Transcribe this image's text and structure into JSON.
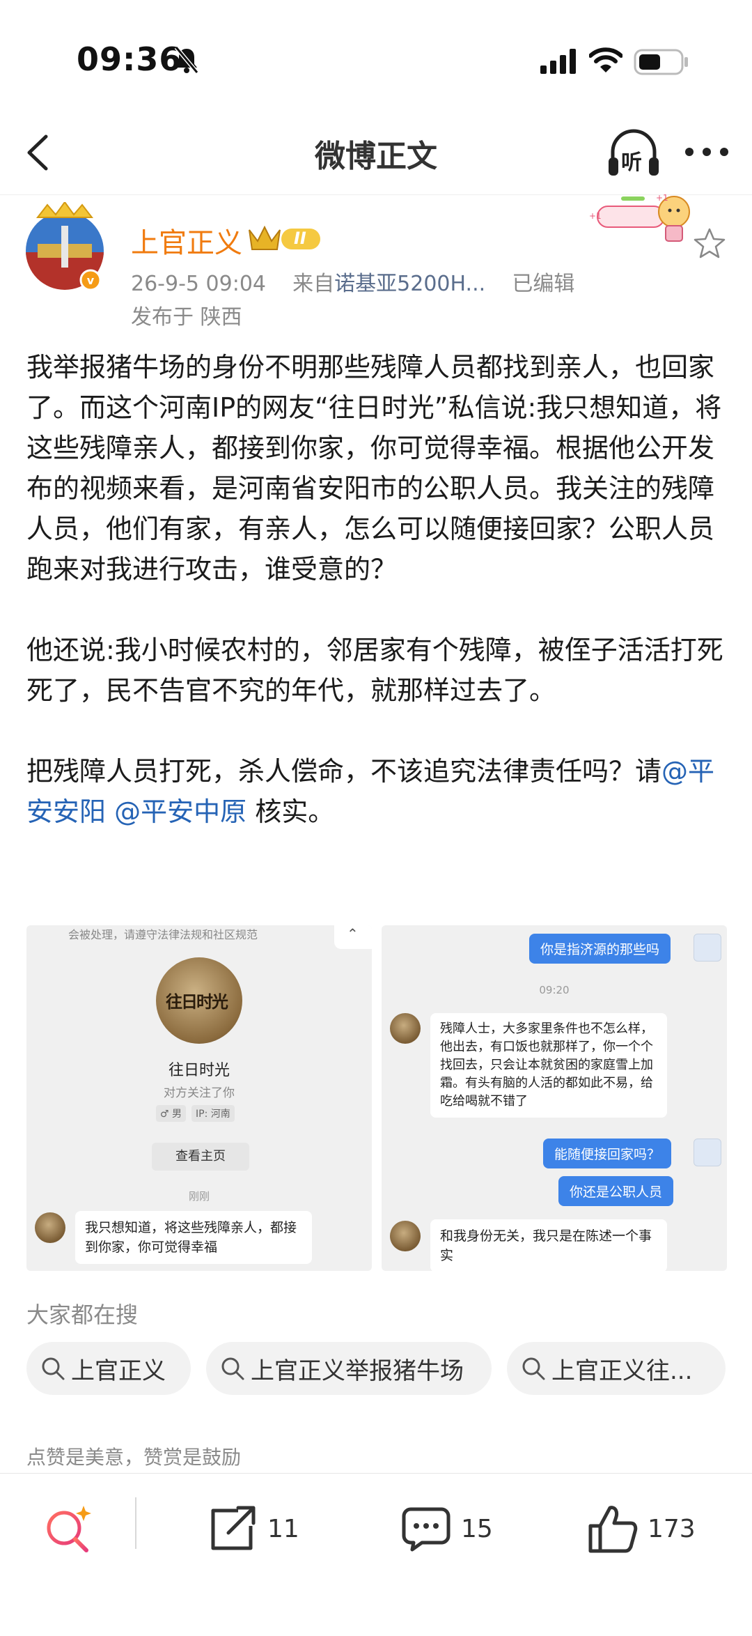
{
  "status_bar": {
    "time": "09:36"
  },
  "nav": {
    "title": "微博正文",
    "listen_label": "听"
  },
  "author": {
    "name": "上官正义",
    "vip_level": "II"
  },
  "meta": {
    "datetime": "26-9-5 09:04",
    "from_prefix": "来自",
    "device": "诺基亚5200H...",
    "edited": "已编辑",
    "location": "发布于 陕西"
  },
  "post": {
    "p1": "我举报猪牛场的身份不明那些残障人员都找到亲人，也回家了。而这个河南IP的网友“往日时光”私信说:我只想知道，将这些残障亲人，都接到你家，你可觉得幸福。根据他公开发布的视频来看，是河南省安阳市的公职人员。我关注的残障人员，他们有家，有亲人，怎么可以随便接回家？公职人员跑来对我进行攻击，谁受意的？",
    "p2": "他还说:我小时候农村的，邻居家有个残障，被侄子活活打死死了，民不告官不究的年代，就那样过去了。",
    "p3_a": "把残障人员打死，杀人偿命，不该追究法律责任吗？请",
    "mention1": "@平安安阳",
    "mention2": "@平安中原",
    "p3_b": " 核实。"
  },
  "image_left": {
    "top_notice": "会被处理，请遵守法律法规和社区规范",
    "avatar_text": "往日时光",
    "profile_name": "往日时光",
    "follows_you": "对方关注了你",
    "gender": "♂ 男",
    "ip": "IP: 河南",
    "view_home": "查看主页",
    "time": "刚刚",
    "message": "我只想知道，将这些残障亲人，都接到你家，你可觉得幸福"
  },
  "image_right": {
    "msg1": "你是指济源的那些吗",
    "time": "09:20",
    "reply1": "残障人士，大多家里条件也不怎么样，他出去，有口饭也就那样了，你一个个找回去，只会让本就贫困的家庭雪上加霜。有头有脑的人活的都如此不易，给吃给喝就不错了",
    "msg2": "能随便接回家吗？",
    "msg3": "你还是公职人员",
    "reply2": "和我身份无关，我只是在陈述一个事实"
  },
  "search": {
    "title": "大家都在搜",
    "chips": [
      "上官正义",
      "上官正义举报猪牛场",
      "上官正义往..."
    ]
  },
  "like_tip": "点赞是美意，赞赏是鼓励",
  "toolbar": {
    "reposts": "11",
    "comments": "15",
    "likes": "173"
  },
  "colors": {
    "author_name": "#f07b0f",
    "mention": "#2563b5",
    "bubble_blue": "#3d83e8",
    "search_accent": "#f35a5a"
  }
}
